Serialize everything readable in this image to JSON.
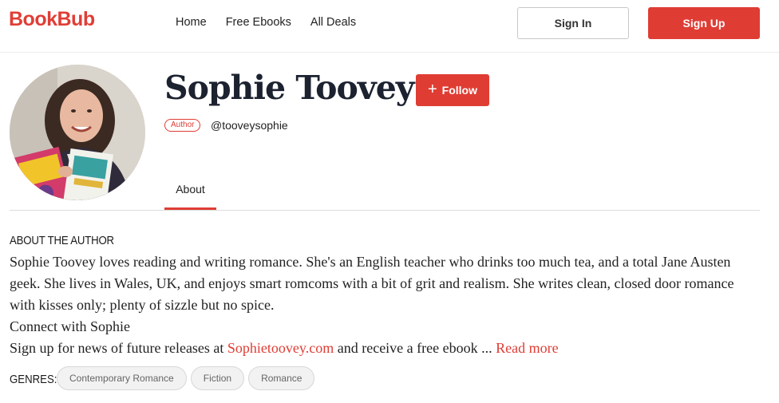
{
  "header": {
    "logo": "BookBub",
    "nav": [
      "Home",
      "Free Ebooks",
      "All Deals"
    ],
    "sign_in": "Sign In",
    "sign_up": "Sign Up"
  },
  "profile": {
    "name": "Sophie Toovey",
    "follow_label": "Follow",
    "badge": "Author",
    "handle": "@tooveysophie"
  },
  "tabs": [
    {
      "label": "About",
      "active": true
    }
  ],
  "about": {
    "heading": "ABOUT THE AUTHOR",
    "bio_paragraph": "Sophie Toovey loves reading and writing romance. She's an English teacher who drinks too much tea, and a total Jane Austen geek. She lives in Wales, UK, and enjoys smart romcoms with a bit of grit and realism. She writes clean, closed door romance with kisses only; plenty of sizzle but no spice.",
    "connect_line": "Connect with Sophie",
    "signup_prefix": "Sign up for news of future releases at ",
    "website_link": "Sophietoovey.com",
    "signup_suffix": " and receive a free ebook ... ",
    "read_more": "Read more"
  },
  "genres": {
    "label": "GENRES:",
    "items": [
      "Contemporary Romance",
      "Fiction",
      "Romance"
    ]
  },
  "colors": {
    "brand_red": "#df3d34",
    "name_navy": "#1c2230"
  }
}
